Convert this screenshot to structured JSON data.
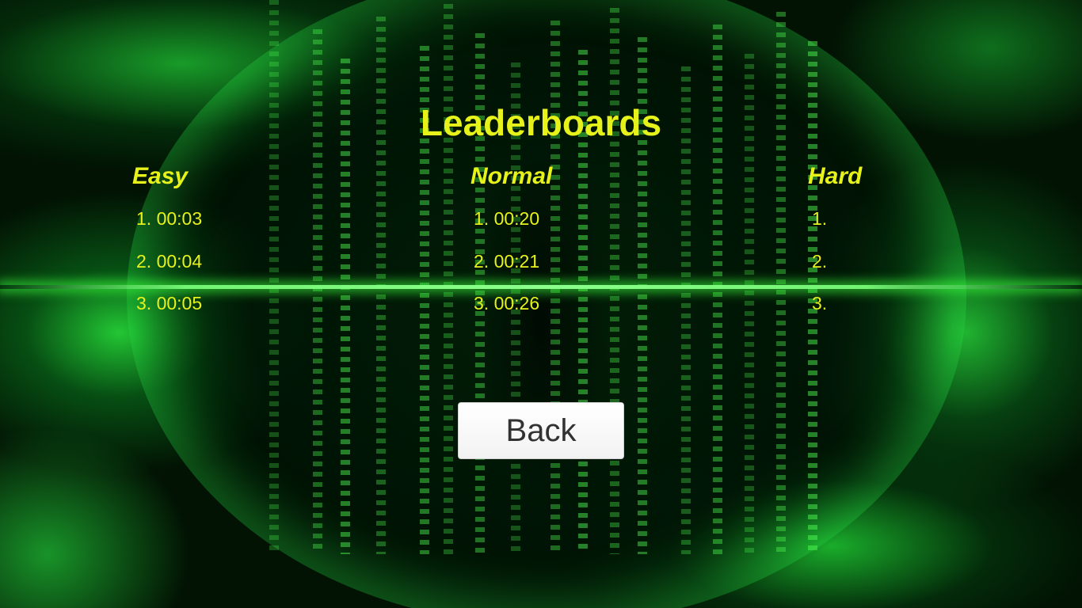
{
  "screen": {
    "title": "Leaderboards"
  },
  "columns": [
    {
      "heading": "Easy",
      "entries": [
        "1. 00:03",
        "2. 00:04",
        "3. 00:05"
      ]
    },
    {
      "heading": "Normal",
      "entries": [
        "1. 00:20",
        "2. 00:21",
        "3. 00:26"
      ]
    },
    {
      "heading": "Hard",
      "entries": [
        "1.",
        "2.",
        "3."
      ]
    }
  ],
  "back_button": {
    "label": "Back"
  },
  "colors": {
    "text_accent": "#e6f21a",
    "button_bg": "#ffffff",
    "button_text": "#323232",
    "background_glow": "#28dc46"
  }
}
